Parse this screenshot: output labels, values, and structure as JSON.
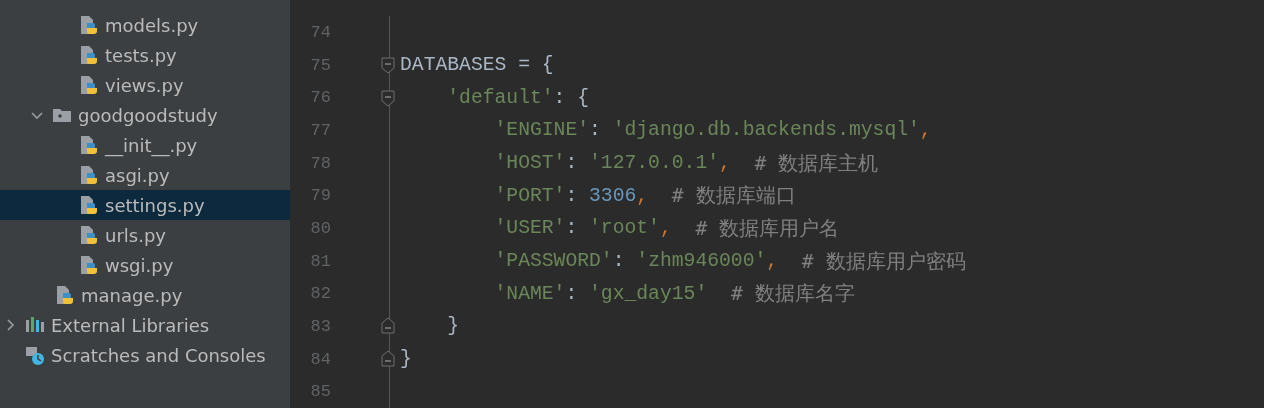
{
  "project_tree": {
    "items": [
      {
        "kind": "offscreen",
        "children": [
          {
            "kind": "offscreen",
            "children": [
              {
                "kind": "python",
                "label": "models.py",
                "selected": false
              },
              {
                "kind": "python",
                "label": "tests.py",
                "selected": false
              },
              {
                "kind": "python",
                "label": "views.py",
                "selected": false
              }
            ]
          },
          {
            "kind": "folder",
            "label": "goodgoodstudy",
            "expanded": true,
            "selected": false,
            "children": [
              {
                "kind": "python",
                "label": "__init__.py",
                "selected": false
              },
              {
                "kind": "python",
                "label": "asgi.py",
                "selected": false
              },
              {
                "kind": "python",
                "label": "settings.py",
                "selected": true
              },
              {
                "kind": "python",
                "label": "urls.py",
                "selected": false
              },
              {
                "kind": "python",
                "label": "wsgi.py",
                "selected": false
              }
            ]
          },
          {
            "kind": "python",
            "label": "manage.py",
            "selected": false
          }
        ]
      },
      {
        "kind": "libraries",
        "label": "External Libraries",
        "expanded": false,
        "selected": false
      },
      {
        "kind": "scratches",
        "label": "Scratches and Consoles",
        "selected": false
      }
    ]
  },
  "editor": {
    "lines": [
      {
        "number": "74"
      },
      {
        "number": "75",
        "fold_open": true,
        "tokens": [
          {
            "kind": "plain",
            "text": "DATABASES = {"
          }
        ]
      },
      {
        "number": "76",
        "fold_open": true,
        "tokens": [
          {
            "kind": "string",
            "text": "    'default'"
          },
          {
            "kind": "plain",
            "text": ": {"
          }
        ]
      },
      {
        "number": "77",
        "tokens": [
          {
            "kind": "string",
            "text": "        'ENGINE'"
          },
          {
            "kind": "plain",
            "text": ": "
          },
          {
            "kind": "string",
            "text": "'django.db.backends.mysql'"
          },
          {
            "kind": "punct",
            "text": ","
          }
        ]
      },
      {
        "number": "78",
        "tokens": [
          {
            "kind": "string",
            "text": "        'HOST'"
          },
          {
            "kind": "plain",
            "text": ": "
          },
          {
            "kind": "string",
            "text": "'127.0.0.1'"
          },
          {
            "kind": "punct",
            "text": ","
          },
          {
            "kind": "comment",
            "text": "  # 数据库主机"
          }
        ]
      },
      {
        "number": "79",
        "tokens": [
          {
            "kind": "string",
            "text": "        'PORT'"
          },
          {
            "kind": "plain",
            "text": ": "
          },
          {
            "kind": "number",
            "text": "3306"
          },
          {
            "kind": "punct",
            "text": ","
          },
          {
            "kind": "comment",
            "text": "  # 数据库端口"
          }
        ]
      },
      {
        "number": "80",
        "tokens": [
          {
            "kind": "string",
            "text": "        'USER'"
          },
          {
            "kind": "plain",
            "text": ": "
          },
          {
            "kind": "string",
            "text": "'root'"
          },
          {
            "kind": "punct",
            "text": ","
          },
          {
            "kind": "comment",
            "text": "  # 数据库用户名"
          }
        ]
      },
      {
        "number": "81",
        "tokens": [
          {
            "kind": "string",
            "text": "        'PASSWORD'"
          },
          {
            "kind": "plain",
            "text": ": "
          },
          {
            "kind": "string",
            "text": "'zhm946000'"
          },
          {
            "kind": "punct",
            "text": ","
          },
          {
            "kind": "comment",
            "text": "  # 数据库用户密码"
          }
        ]
      },
      {
        "number": "82",
        "tokens": [
          {
            "kind": "string",
            "text": "        'NAME'"
          },
          {
            "kind": "plain",
            "text": ": "
          },
          {
            "kind": "string",
            "text": "'gx_day15'"
          },
          {
            "kind": "comment",
            "text": "  # 数据库名字"
          }
        ]
      },
      {
        "number": "83",
        "fold_close": true,
        "tokens": [
          {
            "kind": "plain",
            "text": "    }"
          }
        ]
      },
      {
        "number": "84",
        "fold_close": true,
        "tokens": [
          {
            "kind": "plain",
            "text": "}"
          }
        ]
      },
      {
        "number": "85"
      }
    ]
  }
}
